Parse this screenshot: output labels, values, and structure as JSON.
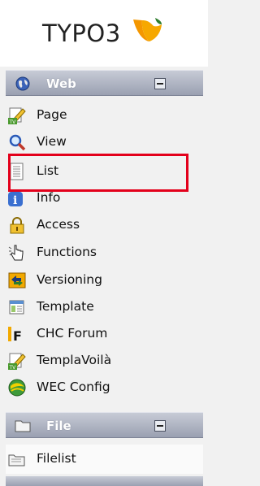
{
  "logo": {
    "text": "TYPO3"
  },
  "sections": [
    {
      "label": "Web",
      "icon": "globe-icon",
      "items": [
        {
          "label": "Page",
          "icon": "page-edit-icon"
        },
        {
          "label": "View",
          "icon": "magnifier-icon"
        },
        {
          "label": "List",
          "icon": "list-icon"
        },
        {
          "label": "Info",
          "icon": "info-icon"
        },
        {
          "label": "Access",
          "icon": "padlock-icon"
        },
        {
          "label": "Functions",
          "icon": "hand-pointer-icon"
        },
        {
          "label": "Versioning",
          "icon": "versioning-icon"
        },
        {
          "label": "Template",
          "icon": "template-icon"
        },
        {
          "label": "CHC Forum",
          "icon": "forum-icon"
        },
        {
          "label": "TemplaVoilà",
          "icon": "templavoila-icon"
        },
        {
          "label": "WEC Config",
          "icon": "wec-config-icon"
        }
      ]
    },
    {
      "label": "File",
      "icon": "folder-icon",
      "items": [
        {
          "label": "Filelist",
          "icon": "filelist-icon"
        }
      ]
    }
  ],
  "highlighted_item": "List",
  "colors": {
    "section_bar": "#a9aebd",
    "highlight_border": "#e3001b",
    "logo_orange": "#f49700"
  }
}
